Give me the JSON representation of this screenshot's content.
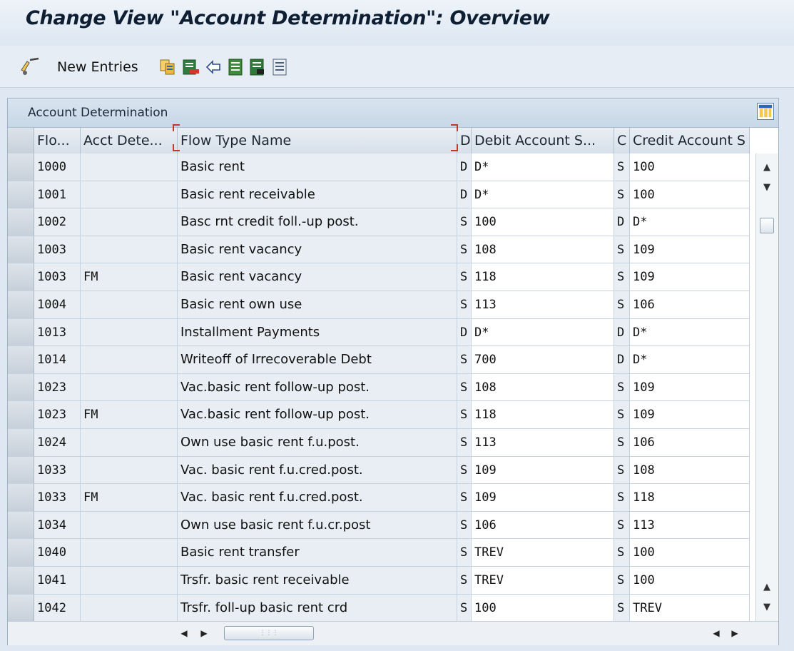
{
  "title": "Change View \"Account Determination\": Overview",
  "toolbar": {
    "new_entries_label": "New Entries",
    "icons": [
      "edit-glasses-icon",
      "copy-icon",
      "delete-icon",
      "undo-icon",
      "select-all-icon",
      "select-block-icon",
      "deselect-all-icon"
    ]
  },
  "panel": {
    "title": "Account Determination",
    "columns": [
      "Flo...",
      "Acct Dete...",
      "Flow Type Name",
      "D",
      "Debit Account S...",
      "C",
      "Credit Account S"
    ],
    "rows": [
      {
        "flow": "1000",
        "acct": "",
        "name": "Basic rent",
        "d": "D",
        "debit": "D*",
        "c": "S",
        "credit": "100"
      },
      {
        "flow": "1001",
        "acct": "",
        "name": "Basic rent receivable",
        "d": "D",
        "debit": "D*",
        "c": "S",
        "credit": "100"
      },
      {
        "flow": "1002",
        "acct": "",
        "name": "Basc rnt credit foll.-up post.",
        "d": "S",
        "debit": "100",
        "c": "D",
        "credit": "D*"
      },
      {
        "flow": "1003",
        "acct": "",
        "name": "Basic rent vacancy",
        "d": "S",
        "debit": "108",
        "c": "S",
        "credit": "109"
      },
      {
        "flow": "1003",
        "acct": "FM",
        "name": "Basic rent vacancy",
        "d": "S",
        "debit": "118",
        "c": "S",
        "credit": "109"
      },
      {
        "flow": "1004",
        "acct": "",
        "name": "Basic rent own use",
        "d": "S",
        "debit": "113",
        "c": "S",
        "credit": "106"
      },
      {
        "flow": "1013",
        "acct": "",
        "name": "Installment Payments",
        "d": "D",
        "debit": "D*",
        "c": "D",
        "credit": "D*"
      },
      {
        "flow": "1014",
        "acct": "",
        "name": "Writeoff of Irrecoverable Debt",
        "d": "S",
        "debit": "700",
        "c": "D",
        "credit": "D*"
      },
      {
        "flow": "1023",
        "acct": "",
        "name": "Vac.basic rent follow-up post.",
        "d": "S",
        "debit": "108",
        "c": "S",
        "credit": "109"
      },
      {
        "flow": "1023",
        "acct": "FM",
        "name": "Vac.basic rent follow-up post.",
        "d": "S",
        "debit": "118",
        "c": "S",
        "credit": "109"
      },
      {
        "flow": "1024",
        "acct": "",
        "name": "Own use basic rent f.u.post.",
        "d": "S",
        "debit": "113",
        "c": "S",
        "credit": "106"
      },
      {
        "flow": "1033",
        "acct": "",
        "name": "Vac. basic rent f.u.cred.post.",
        "d": "S",
        "debit": "109",
        "c": "S",
        "credit": "108"
      },
      {
        "flow": "1033",
        "acct": "FM",
        "name": "Vac. basic rent f.u.cred.post.",
        "d": "S",
        "debit": "109",
        "c": "S",
        "credit": "118"
      },
      {
        "flow": "1034",
        "acct": "",
        "name": "Own use basic rent f.u.cr.post",
        "d": "S",
        "debit": "106",
        "c": "S",
        "credit": "113"
      },
      {
        "flow": "1040",
        "acct": "",
        "name": "Basic rent transfer",
        "d": "S",
        "debit": "TREV",
        "c": "S",
        "credit": "100"
      },
      {
        "flow": "1041",
        "acct": "",
        "name": "Trsfr. basic rent receivable",
        "d": "S",
        "debit": "TREV",
        "c": "S",
        "credit": "100"
      },
      {
        "flow": "1042",
        "acct": "",
        "name": "Trsfr. foll-up basic rent crd",
        "d": "S",
        "debit": "100",
        "c": "S",
        "credit": "TREV"
      }
    ]
  }
}
